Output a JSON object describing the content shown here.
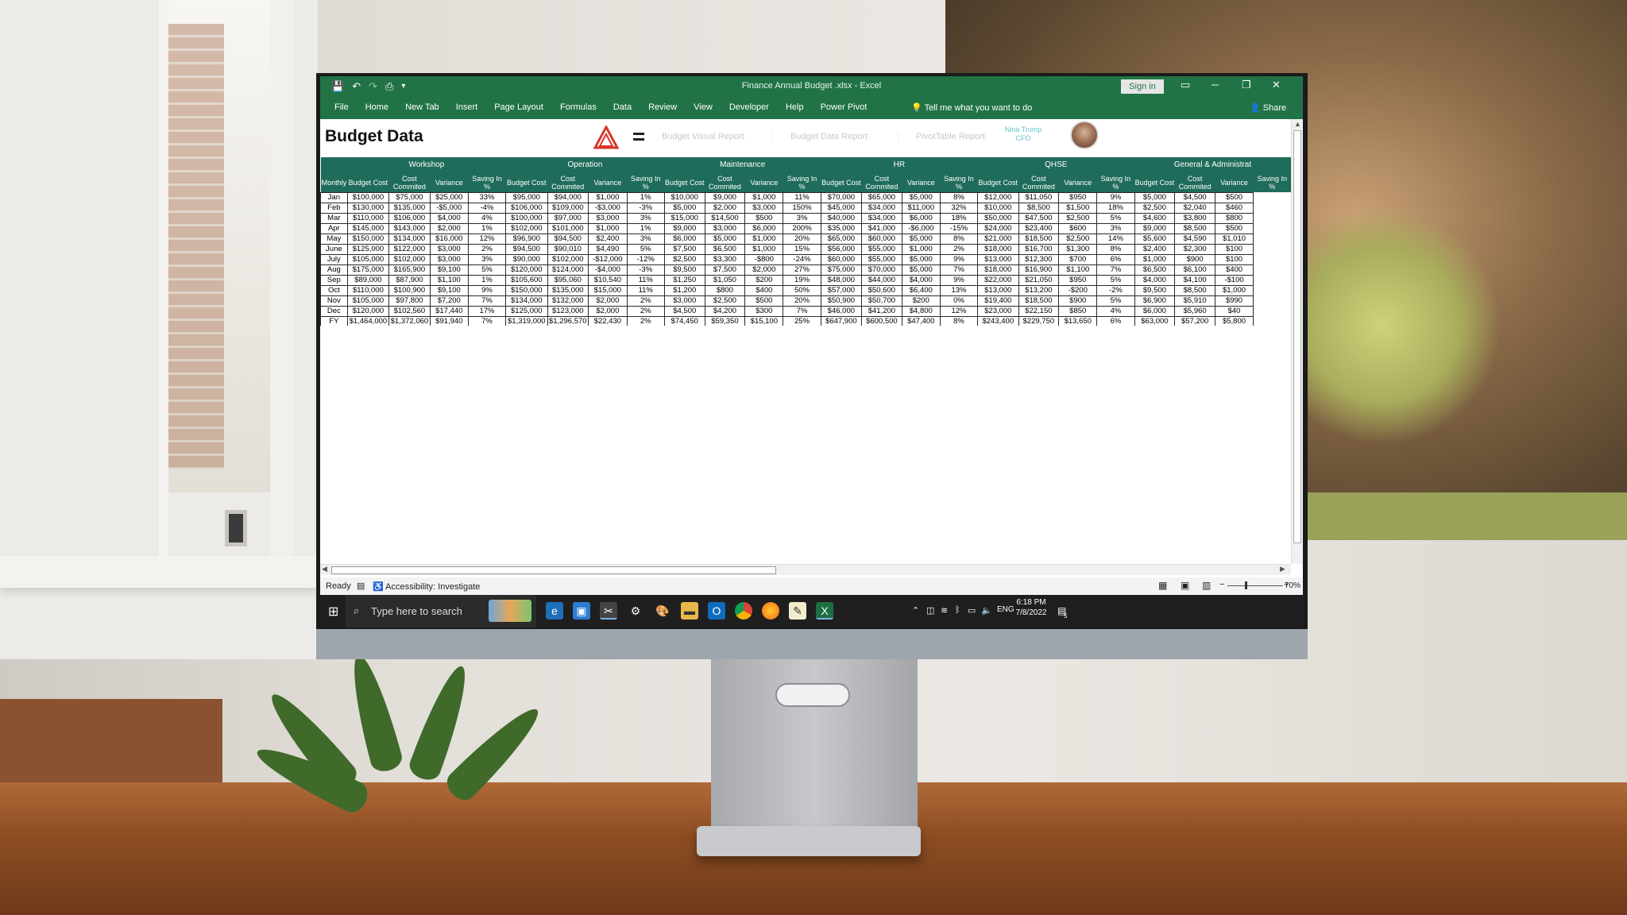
{
  "window": {
    "doc_title": "Finance Annual Budget .xlsx  -  Excel",
    "sign_in": "Sign in",
    "controls": {
      "ribbon_display": "▭",
      "minimize": "─",
      "restore": "❐",
      "close": "✕"
    }
  },
  "qat": {
    "save": "💾",
    "undo": "↶",
    "redo": "↷",
    "print_preview": "⎙",
    "customize": "▾"
  },
  "ribbon": {
    "tabs": [
      "File",
      "Home",
      "New Tab",
      "Insert",
      "Page Layout",
      "Formulas",
      "Data",
      "Review",
      "View",
      "Developer",
      "Help",
      "Power Pivot"
    ],
    "tell_me": "Tell me what you want to do",
    "share": "Share"
  },
  "sheet": {
    "title": "Budget Data",
    "nav": [
      "Budget Visual Report",
      "Budget Data Report",
      "PivotTable Report"
    ],
    "user_name": "Nina Trump",
    "user_role": "CFO"
  },
  "table": {
    "groups": [
      "Workshop",
      "Operation",
      "Maintenance",
      "HR",
      "QHSE",
      "General & Administrat"
    ],
    "col_headers": [
      "Budget Cost",
      "Cost Commited",
      "Variance",
      "Saving In %"
    ],
    "month_header": "Monthly",
    "rows": [
      {
        "m": "Jan",
        "v": [
          "$100,000",
          "$75,000",
          "$25,000",
          "33%",
          "$95,000",
          "$94,000",
          "$1,000",
          "1%",
          "$10,000",
          "$9,000",
          "$1,000",
          "11%",
          "$70,000",
          "$65,000",
          "$5,000",
          "8%",
          "$12,000",
          "$11,050",
          "$950",
          "9%",
          "$5,000",
          "$4,500",
          "$500"
        ]
      },
      {
        "m": "Feb",
        "v": [
          "$130,000",
          "$135,000",
          "-$5,000",
          "-4%",
          "$106,000",
          "$109,000",
          "-$3,000",
          "-3%",
          "$5,000",
          "$2,000",
          "$3,000",
          "150%",
          "$45,000",
          "$34,000",
          "$11,000",
          "32%",
          "$10,000",
          "$8,500",
          "$1,500",
          "18%",
          "$2,500",
          "$2,040",
          "$460"
        ]
      },
      {
        "m": "Mar",
        "v": [
          "$110,000",
          "$106,000",
          "$4,000",
          "4%",
          "$100,000",
          "$97,000",
          "$3,000",
          "3%",
          "$15,000",
          "$14,500",
          "$500",
          "3%",
          "$40,000",
          "$34,000",
          "$6,000",
          "18%",
          "$50,000",
          "$47,500",
          "$2,500",
          "5%",
          "$4,600",
          "$3,800",
          "$800"
        ]
      },
      {
        "m": "Apr",
        "v": [
          "$145,000",
          "$143,000",
          "$2,000",
          "1%",
          "$102,000",
          "$101,000",
          "$1,000",
          "1%",
          "$9,000",
          "$3,000",
          "$6,000",
          "200%",
          "$35,000",
          "$41,000",
          "-$6,000",
          "-15%",
          "$24,000",
          "$23,400",
          "$600",
          "3%",
          "$9,000",
          "$8,500",
          "$500"
        ]
      },
      {
        "m": "May",
        "v": [
          "$150,000",
          "$134,000",
          "$16,000",
          "12%",
          "$96,900",
          "$94,500",
          "$2,400",
          "3%",
          "$6,000",
          "$5,000",
          "$1,000",
          "20%",
          "$65,000",
          "$60,000",
          "$5,000",
          "8%",
          "$21,000",
          "$18,500",
          "$2,500",
          "14%",
          "$5,600",
          "$4,590",
          "$1,010"
        ]
      },
      {
        "m": "June",
        "v": [
          "$125,000",
          "$122,000",
          "$3,000",
          "2%",
          "$94,500",
          "$90,010",
          "$4,490",
          "5%",
          "$7,500",
          "$6,500",
          "$1,000",
          "15%",
          "$56,000",
          "$55,000",
          "$1,000",
          "2%",
          "$18,000",
          "$16,700",
          "$1,300",
          "8%",
          "$2,400",
          "$2,300",
          "$100"
        ]
      },
      {
        "m": "July",
        "v": [
          "$105,000",
          "$102,000",
          "$3,000",
          "3%",
          "$90,000",
          "$102,000",
          "-$12,000",
          "-12%",
          "$2,500",
          "$3,300",
          "-$800",
          "-24%",
          "$60,000",
          "$55,000",
          "$5,000",
          "9%",
          "$13,000",
          "$12,300",
          "$700",
          "6%",
          "$1,000",
          "$900",
          "$100"
        ]
      },
      {
        "m": "Aug",
        "v": [
          "$175,000",
          "$165,900",
          "$9,100",
          "5%",
          "$120,000",
          "$124,000",
          "-$4,000",
          "-3%",
          "$9,500",
          "$7,500",
          "$2,000",
          "27%",
          "$75,000",
          "$70,000",
          "$5,000",
          "7%",
          "$18,000",
          "$16,900",
          "$1,100",
          "7%",
          "$6,500",
          "$6,100",
          "$400"
        ]
      },
      {
        "m": "Sep",
        "v": [
          "$89,000",
          "$87,900",
          "$1,100",
          "1%",
          "$105,600",
          "$95,060",
          "$10,540",
          "11%",
          "$1,250",
          "$1,050",
          "$200",
          "19%",
          "$48,000",
          "$44,000",
          "$4,000",
          "9%",
          "$22,000",
          "$21,050",
          "$950",
          "5%",
          "$4,000",
          "$4,100",
          "-$100"
        ]
      },
      {
        "m": "Oct",
        "v": [
          "$110,000",
          "$100,900",
          "$9,100",
          "9%",
          "$150,000",
          "$135,000",
          "$15,000",
          "11%",
          "$1,200",
          "$800",
          "$400",
          "50%",
          "$57,000",
          "$50,600",
          "$6,400",
          "13%",
          "$13,000",
          "$13,200",
          "-$200",
          "-2%",
          "$9,500",
          "$8,500",
          "$1,000"
        ]
      },
      {
        "m": "Nov",
        "v": [
          "$105,000",
          "$97,800",
          "$7,200",
          "7%",
          "$134,000",
          "$132,000",
          "$2,000",
          "2%",
          "$3,000",
          "$2,500",
          "$500",
          "20%",
          "$50,900",
          "$50,700",
          "$200",
          "0%",
          "$19,400",
          "$18,500",
          "$900",
          "5%",
          "$6,900",
          "$5,910",
          "$990"
        ]
      },
      {
        "m": "Dec",
        "v": [
          "$120,000",
          "$102,560",
          "$17,440",
          "17%",
          "$125,000",
          "$123,000",
          "$2,000",
          "2%",
          "$4,500",
          "$4,200",
          "$300",
          "7%",
          "$46,000",
          "$41,200",
          "$4,800",
          "12%",
          "$23,000",
          "$22,150",
          "$850",
          "4%",
          "$6,000",
          "$5,960",
          "$40"
        ]
      },
      {
        "m": "FY",
        "v": [
          "$1,464,000",
          "$1,372,060",
          "$91,940",
          "7%",
          "$1,319,000",
          "$1,296,570",
          "$22,430",
          "2%",
          "$74,450",
          "$59,350",
          "$15,100",
          "25%",
          "$647,900",
          "$600,500",
          "$47,400",
          "8%",
          "$243,400",
          "$229,750",
          "$13,650",
          "6%",
          "$63,000",
          "$57,200",
          "$5,800"
        ]
      }
    ]
  },
  "status": {
    "ready": "Ready",
    "accessibility": "Accessibility: Investigate",
    "zoom": "70%"
  },
  "taskbar": {
    "search_placeholder": "Type here to search",
    "time": "6:18 PM",
    "date": "7/8/2022",
    "lang": "ENG",
    "notification_count": "5"
  },
  "colors": {
    "excel_green": "#217346",
    "table_header": "#1f6c5b",
    "user_cyan": "#63c3c9"
  }
}
